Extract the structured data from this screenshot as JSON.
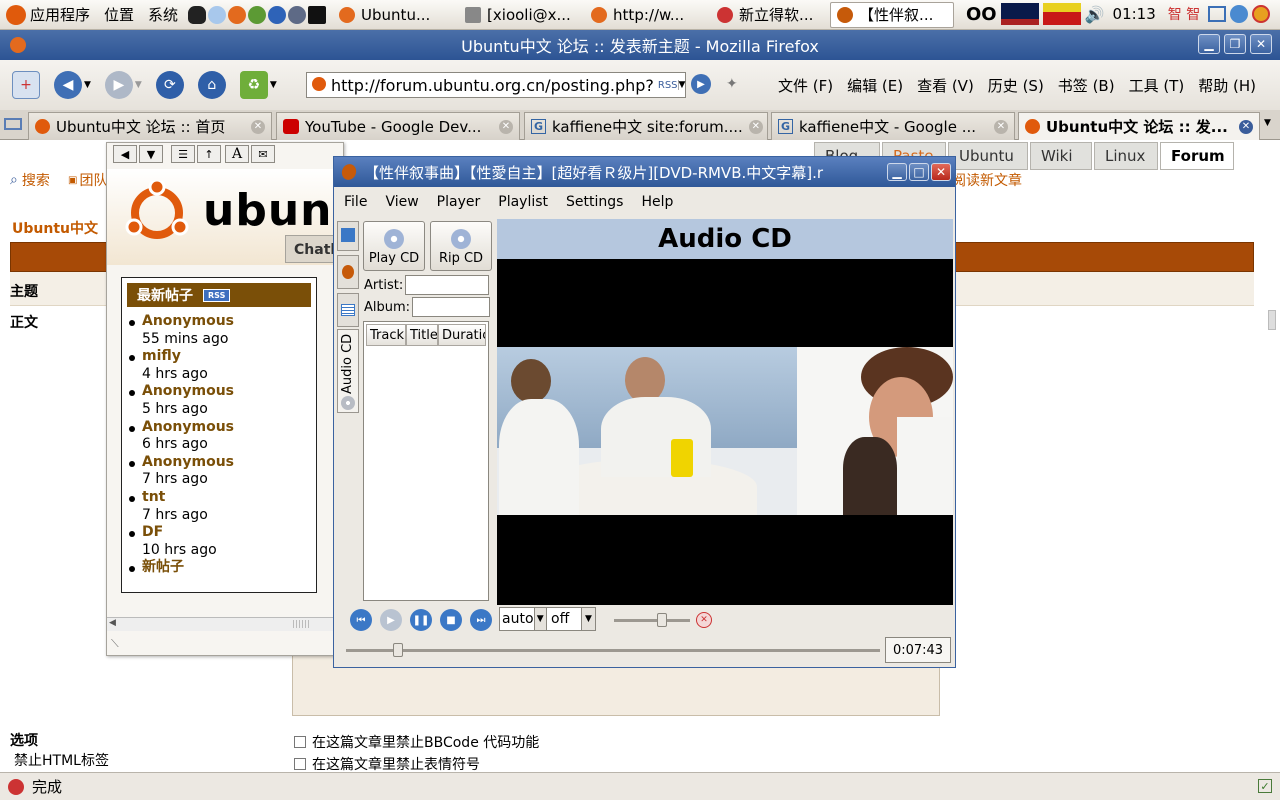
{
  "panel": {
    "menu_apps": "应用程序",
    "menu_places": "位置",
    "menu_system": "系统",
    "tasks": [
      "Ubuntu...",
      "[xiooli@x...",
      "http://w...",
      "新立得软...",
      "【性伴叙..."
    ],
    "clock": "01:13",
    "input_method": "智 智"
  },
  "firefox": {
    "title": "Ubuntu中文 论坛 :: 发表新主题 - Mozilla Firefox",
    "url": "http://forum.ubuntu.org.cn/posting.php?",
    "rss": "RSS",
    "menus": [
      "文件 (F)",
      "编辑 (E)",
      "查看 (V)",
      "历史 (S)",
      "书签 (B)",
      "工具 (T)",
      "帮助 (H)"
    ],
    "tabs": [
      {
        "label": "Ubuntu中文 论坛 :: 首页",
        "icon": "ubuntu-icon"
      },
      {
        "label": "YouTube - Google Dev...",
        "icon": "youtube-icon"
      },
      {
        "label": "kaffiene中文 site:forum....",
        "icon": "google-icon"
      },
      {
        "label": "kaffiene中文 - Google ...",
        "icon": "google-icon"
      },
      {
        "label": "Ubuntu中文 论坛 :: 发...",
        "icon": "ubuntu-icon"
      }
    ],
    "status": "完成"
  },
  "forum": {
    "nav_tabs": [
      "Blog",
      "Paste",
      "Ubuntu",
      "Wiki",
      "Linux",
      "Forum"
    ],
    "search": "搜索",
    "group": "团队",
    "unread": "阅读新文章",
    "breadcrumb": "Ubuntu中文",
    "subject_label": "主题",
    "body_label": "正文",
    "options_label": "选项",
    "html_off": "禁止HTML标签",
    "opt_bbcode": "在这篇文章里禁止BBCode 代码功能",
    "opt_smilies": "在这篇文章里禁止表情符号"
  },
  "popup": {
    "header_tab": "Chatl",
    "recent_title": "最新帖子",
    "rss": "RSS",
    "items": [
      {
        "name": "Anonymous",
        "time": "55 mins ago"
      },
      {
        "name": "mifly",
        "time": "4 hrs ago"
      },
      {
        "name": "Anonymous",
        "time": "5 hrs ago"
      },
      {
        "name": "Anonymous",
        "time": "6 hrs ago"
      },
      {
        "name": "Anonymous",
        "time": "7 hrs ago"
      },
      {
        "name": "tnt",
        "time": "7 hrs ago"
      },
      {
        "name": "DF",
        "time": "10 hrs ago"
      }
    ],
    "new_posts": "新帖子"
  },
  "player": {
    "title": "【性伴叙事曲】【性愛自主】[超好看Ｒ级片][DVD-RMVB.中文字幕].r",
    "menus": [
      "File",
      "View",
      "Player",
      "Playlist",
      "Settings",
      "Help"
    ],
    "play_cd": "Play CD",
    "rip_cd": "Rip CD",
    "artist_label": "Artist:",
    "album_label": "Album:",
    "columns": [
      "Track",
      "Title",
      "Duratic"
    ],
    "side_tab": "Audio CD",
    "video_header": "Audio CD",
    "aspect": "auto",
    "subtitle": "off",
    "time": "0:07:43",
    "volume_level": 0.65,
    "seek_position": 0.09
  },
  "colors": {
    "accent": "#7a4f08",
    "forum_orange": "#c35a00",
    "titlebar": "#3a62a0"
  }
}
